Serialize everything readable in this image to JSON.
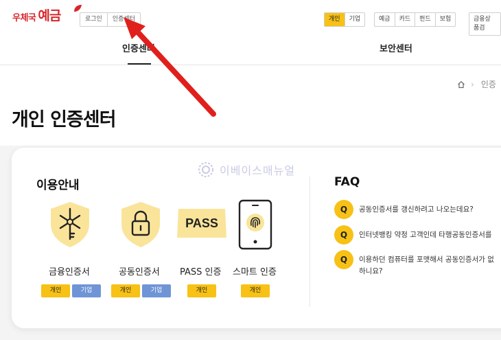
{
  "header": {
    "logo_small": "우체국",
    "logo_big": "예금",
    "auth_links": [
      "로그인",
      "인증센터"
    ],
    "user_types": [
      "개인",
      "기업"
    ],
    "products": [
      "예금",
      "카드",
      "펀드",
      "보험"
    ],
    "more_label": "금융상품검"
  },
  "tabs": [
    "인증센터",
    "보안센터"
  ],
  "breadcrumb": {
    "current": "인증"
  },
  "page_title": "개인 인증센터",
  "watermark": "이베이스매뉴얼",
  "usage": {
    "title": "이용안내",
    "services": [
      {
        "name": "금융인증서",
        "badges": [
          "개인",
          "기업"
        ],
        "icon": "key-shield-icon"
      },
      {
        "name": "공동인증서",
        "badges": [
          "개인",
          "기업"
        ],
        "icon": "lock-shield-icon"
      },
      {
        "name": "PASS 인증",
        "badges": [
          "개인"
        ],
        "icon": "pass-icon",
        "icon_text": "PASS"
      },
      {
        "name": "스마트 인증",
        "badges": [
          "개인"
        ],
        "icon": "phone-fingerprint-icon"
      }
    ]
  },
  "faq": {
    "title": "FAQ",
    "q_label": "Q",
    "items": [
      {
        "text": "공동인증서를 갱신하려고 나오는데요?"
      },
      {
        "text": "인터넷뱅킹 약정 고객인데 타행공동인증서를"
      },
      {
        "text": "이용하던 컴퓨터를 포맷해서 공동인증서가 없",
        "text2": "하니요?"
      }
    ]
  },
  "colors": {
    "accent": "#f7c115",
    "brand_red": "#d8262b",
    "biz_blue": "#6f95d6",
    "arrow_red": "#e0201c",
    "shield": "#f9e49a"
  }
}
